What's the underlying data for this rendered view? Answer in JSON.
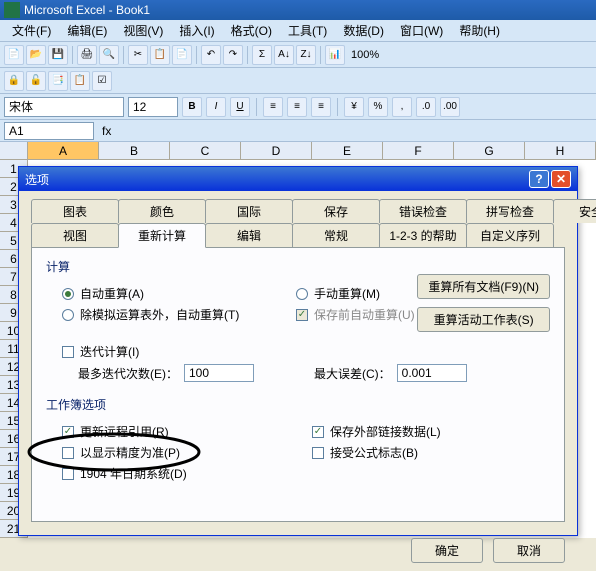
{
  "title": "Microsoft Excel - Book1",
  "menu": [
    "文件(F)",
    "编辑(E)",
    "视图(V)",
    "插入(I)",
    "格式(O)",
    "工具(T)",
    "数据(D)",
    "窗口(W)",
    "帮助(H)"
  ],
  "zoom": "100%",
  "font_name": "宋体",
  "font_size": "12",
  "format_btns": {
    "bold": "B",
    "italic": "I",
    "underline": "U"
  },
  "namebox": "A1",
  "cols": [
    "A",
    "B",
    "C",
    "D",
    "E",
    "F",
    "G",
    "H"
  ],
  "rows": [
    "1",
    "2",
    "3",
    "4",
    "5",
    "6",
    "7",
    "8",
    "9",
    "10",
    "11",
    "12",
    "13",
    "14",
    "15",
    "16",
    "17",
    "18",
    "19",
    "20",
    "21"
  ],
  "dialog": {
    "title": "选项",
    "tabs_row1": [
      "图表",
      "颜色",
      "国际",
      "保存",
      "错误检查",
      "拼写检查",
      "安全性"
    ],
    "tabs_row2": [
      "视图",
      "重新计算",
      "编辑",
      "常规",
      "1-2-3 的帮助",
      "自定义序列"
    ],
    "active_tab": "重新计算",
    "group_calc": "计算",
    "radio_auto": "自动重算(A)",
    "radio_manual": "手动重算(M)",
    "radio_except": "除模拟运算表外，自动重算(T)",
    "chk_save_recalc": "保存前自动重算(U)",
    "btn_recalc_all": "重算所有文档(F9)(N)",
    "btn_recalc_sheet": "重算活动工作表(S)",
    "chk_iter": "迭代计算(I)",
    "lbl_max_iter": "最多迭代次数(E)：",
    "val_max_iter": "100",
    "lbl_max_err": "最大误差(C)：",
    "val_max_err": "0.001",
    "group_wb": "工作簿选项",
    "chk_update_remote": "更新远程引用(R)",
    "chk_precision": "以显示精度为准(P)",
    "chk_1904": "1904 年日期系统(D)",
    "chk_save_ext": "保存外部链接数据(L)",
    "chk_accept_formula": "接受公式标志(B)",
    "ok": "确定",
    "cancel": "取消"
  }
}
